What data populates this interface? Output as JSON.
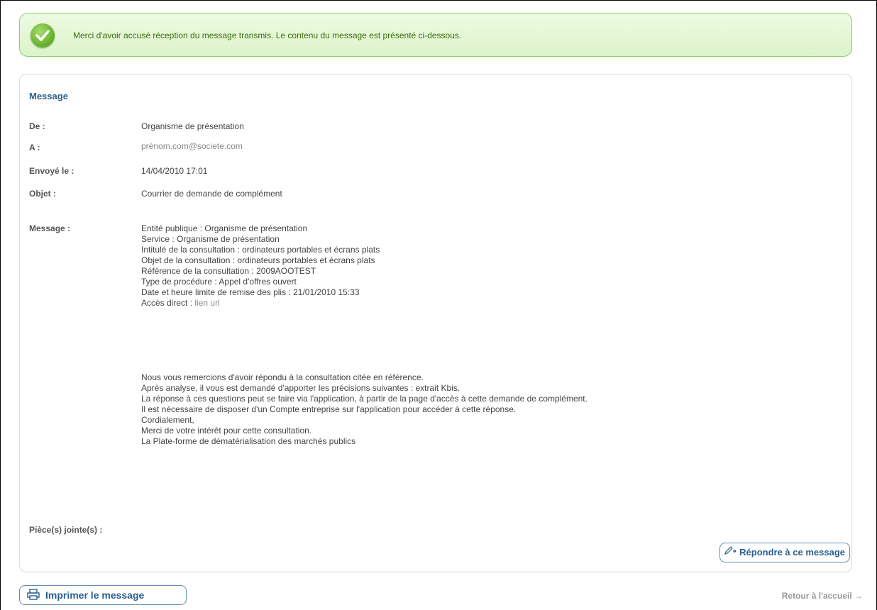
{
  "banner": {
    "message": "Merci d'avoir accusé réception du message transmis. Le contenu du message est présenté ci-dessous."
  },
  "panel": {
    "title": "Message",
    "fields": {
      "from_label": "De :",
      "from_value": "Organisme de présentation",
      "to_label": "A :",
      "to_value": "prénom.com@societe.com",
      "sent_label": "Envoyé le :",
      "sent_value": "14/04/2010 17:01",
      "subject_label": "Objet :",
      "subject_value": "Courrier de demande de complément",
      "message_label": "Message :",
      "attachments_label": "Pièce(s) jointe(s) :"
    },
    "message_lines": [
      "Entité publique : Organisme de présentation",
      "Service : Organisme de présentation",
      "Intitulé de la consultation : ordinateurs portables et écrans plats",
      "Objet de la consultation : ordinateurs portables et écrans plats",
      "Référence de la consultation : 2009AOOTEST",
      "Type de procédure : Appel d'offres ouvert",
      "Date et heure limite de remise des plis : 21/01/2010 15:33"
    ],
    "direct_access_label": "Accès direct :",
    "direct_access_link": "lien url",
    "closing_lines": [
      "Nous vous remercions d'avoir répondu à la consultation citée en référence.",
      "Après analyse, il vous est demandé d'apporter les précisions suivantes : extrait Kbis.",
      "La réponse à ces questions peut se faire via l'application, à partir de la page d'accès à cette demande de complément.",
      "Il est nécessaire de disposer d'un Compte entreprise sur l'application pour accéder à cette réponse.",
      "Cordialement,",
      "Merci de votre intérêt pour cette consultation.",
      "La Plate-forme de dématérialisation des marchés publics"
    ],
    "reply_button": "Répondre à ce message"
  },
  "footer": {
    "print_button": "Imprimer le message",
    "home_link": "Retour à l'accueil"
  },
  "icons": {
    "success": "check-circle-icon",
    "reply": "pencil-icon",
    "print": "printer-icon",
    "arrow": "arrow-right-icon"
  },
  "colors": {
    "accent": "#2b5f8e",
    "success_border": "#8fcb63",
    "success_text": "#3a6b0d"
  }
}
